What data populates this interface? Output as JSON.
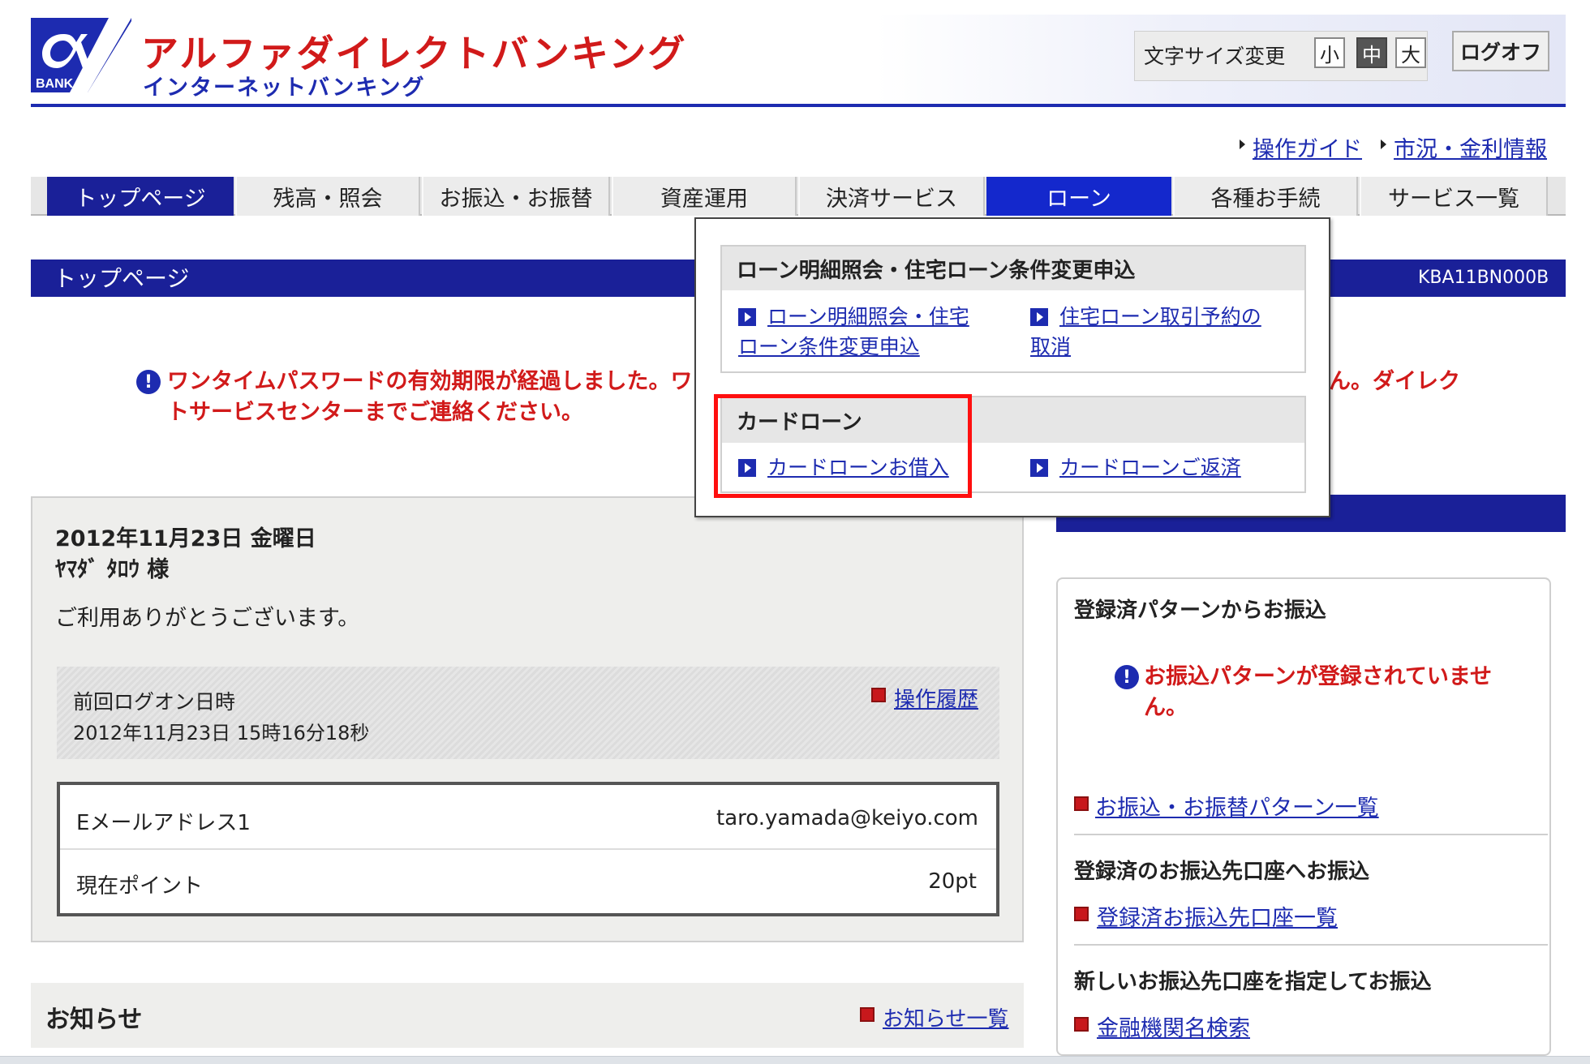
{
  "header": {
    "logo_text": "BANK",
    "bank_name": "アルファダイレクトバンキング",
    "subtitle": "インターネットバンキング",
    "font_size_label": "文字サイズ変更",
    "font_sizes": [
      "小",
      "中",
      "大"
    ],
    "font_size_selected": "中",
    "logoff": "ログオフ",
    "util_links": [
      "操作ガイド",
      "市況・金利情報"
    ]
  },
  "nav": {
    "tabs": [
      "トップページ",
      "残高・照会",
      "お振込・お振替",
      "資産運用",
      "決済サービス",
      "ローン",
      "各種お手続",
      "サービス一覧"
    ],
    "active": "トップページ",
    "hovered": "ローン"
  },
  "page": {
    "title": "トップページ",
    "screen_id": "KBA11BN000B"
  },
  "error": {
    "line1": "ワンタイムパスワードの有効期限が経過しました。ワ",
    "line1_tail": "ん。ダイレク",
    "line2": "トサービスセンターまでご連絡ください。"
  },
  "user": {
    "date": "2012年11月23日 金曜日",
    "name": "ﾔﾏﾀﾞ ﾀﾛｳ 様",
    "thanks": "ご利用ありがとうございます。",
    "last_logon_label": "前回ログオン日時",
    "last_logon_value": "2012年11月23日 15時16分18秒",
    "history_link": "操作履歴",
    "email_label": "Eメールアドレス1",
    "email_value": "taro.yamada@keiyo.com",
    "points_label": "現在ポイント",
    "points_value": "20pt"
  },
  "news": {
    "title": "お知らせ",
    "list_link": "お知らせ一覧"
  },
  "transfer": {
    "section1_title": "登録済パターンからお振込",
    "section1_error": "お振込パターンが登録されていませ",
    "section1_error2": "ん。",
    "section1_link": "お振込・お振替パターン一覧",
    "section2_title": "登録済のお振込先口座へお振込",
    "section2_link": "登録済お振込先口座一覧",
    "section3_title": "新しいお振込先口座を指定してお振込",
    "section3_link": "金融機関名検索"
  },
  "loan_menu": {
    "section1_title": "ローン明細照会・住宅ローン条件変更申込",
    "link1_line1": "ローン明細照会・住宅",
    "link1_line2": "ローン条件変更申込",
    "link2_line1": "住宅ローン取引予約の",
    "link2_line2": "取消",
    "section2_title": "カードローン",
    "link3": "カードローンお借入",
    "link4": "カードローンご返済"
  },
  "colors": {
    "brand_red": "#d11a1a",
    "brand_blue": "#1d2bb0",
    "nav_active": "#1a2098",
    "highlight": "#ff0f0f"
  }
}
